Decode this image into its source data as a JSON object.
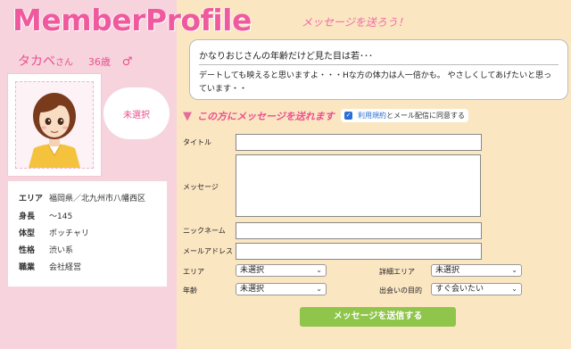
{
  "header": {
    "logo_text": "MemberProfile",
    "tagline": "メッセージを送ろう！"
  },
  "profile": {
    "name": "タカベ",
    "honorific": "さん",
    "age": "36歳",
    "gender_symbol": "♂",
    "bubble_text": "未選択",
    "details": [
      {
        "label": "エリア",
        "value": "福岡県／北九州市八幡西区"
      },
      {
        "label": "身長",
        "value": "〜145"
      },
      {
        "label": "体型",
        "value": "ポッチャリ"
      },
      {
        "label": "性格",
        "value": "渋い系"
      },
      {
        "label": "職業",
        "value": "会社経営"
      }
    ]
  },
  "message_card": {
    "title": "かなりおじさんの年齢だけど見た目は若･･･",
    "body": "デートしても映えると思いますよ・・・Hな方の体力は人一倍かも。 やさしくしてあげたいと思っています・・"
  },
  "form": {
    "heading": "この方にメッセージを送れます",
    "agree_link": "利用規約",
    "agree_rest": "とメール配信に同意する",
    "labels": {
      "title": "タイトル",
      "message": "メッセージ",
      "nickname": "ニックネーム",
      "email": "メールアドレス",
      "area": "エリア",
      "detail_area": "詳細エリア",
      "age": "年齢",
      "purpose": "出会いの目的"
    },
    "selects": {
      "area": "未選択",
      "detail_area": "未選択",
      "age": "未選択",
      "purpose": "すぐ会いたい"
    },
    "submit_label": "メッセージを送信する"
  },
  "colors": {
    "accent_pink": "#ec4f8f",
    "left_bg": "#f6d3dd",
    "main_bg": "#fbe6c2",
    "submit_green": "#8fc54a",
    "link_blue": "#2b6fd6"
  },
  "icons": [
    "male-icon",
    "arrow-down-icon",
    "checkbox-checked-icon",
    "chevron-down-icon"
  ]
}
